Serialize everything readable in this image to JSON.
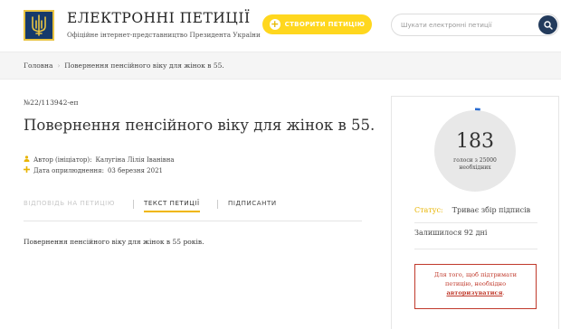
{
  "header": {
    "title": "ЕЛЕКТРОННІ ПЕТИЦІЇ",
    "subtitle": "Офіційне інтернет-представництво Президента України",
    "create_button": "СТВОРИТИ ПЕТИЦІЮ",
    "search_placeholder": "Шукати електронні петиції",
    "colors": {
      "accent": "#ffd71e",
      "brand": "#163a6b",
      "search_button": "#233b5c"
    }
  },
  "breadcrumb": {
    "home": "Головна",
    "current": "Повернення пенсійного віку для жінок в 55."
  },
  "petition": {
    "id": "№22/113942-еп",
    "title": "Повернення пенсійного віку для жінок в 55.",
    "author_label": "Автор (ініціатор):",
    "author": "Калугіна Лілія Іванівна",
    "date_label": "Дата оприлюднення:",
    "date": "03 березня 2021",
    "body": "Повернення пенсійного віку для жінок в 55 років."
  },
  "tabs": [
    {
      "label": "ВІДПОВІДЬ НА ПЕТИЦІЮ",
      "state": "disabled"
    },
    {
      "label": "ТЕКСТ ПЕТИЦІЇ",
      "state": "active"
    },
    {
      "label": "ПІДПИСАНТИ",
      "state": "normal"
    }
  ],
  "sidebar": {
    "votes": "183",
    "goal_line1": "голоси з 25000",
    "goal_line2": "необхідних",
    "progress": 0.00732,
    "status_label": "Статус:",
    "status_value": "Триває збір підписів",
    "remaining": "Залишилося 92 дні",
    "auth_text_1": "Для того, щоб підтримати",
    "auth_text_2": "петицію, необхідно",
    "auth_link": "авторизуватися",
    "auth_suffix": "."
  }
}
